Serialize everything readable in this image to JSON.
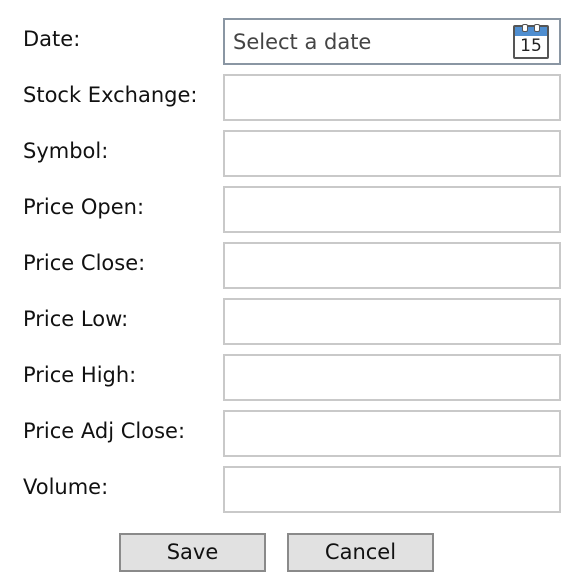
{
  "form": {
    "date": {
      "label": "Date:",
      "placeholder": "Select a date",
      "calendar_day": "15",
      "icon": "calendar-icon"
    },
    "stock_exchange": {
      "label": "Stock Exchange:",
      "value": ""
    },
    "symbol": {
      "label": "Symbol:",
      "value": ""
    },
    "price_open": {
      "label": "Price Open:",
      "value": ""
    },
    "price_close": {
      "label": "Price Close:",
      "value": ""
    },
    "price_low": {
      "label": "Price Low:",
      "value": ""
    },
    "price_high": {
      "label": "Price High:",
      "value": ""
    },
    "price_adj_close": {
      "label": "Price Adj Close:",
      "value": ""
    },
    "volume": {
      "label": "Volume:",
      "value": ""
    }
  },
  "actions": {
    "save_label": "Save",
    "cancel_label": "Cancel"
  },
  "colors": {
    "calendar_header": "#4f8ed0",
    "button_background": "#e1e1e1",
    "field_border": "#c9c9c9"
  }
}
